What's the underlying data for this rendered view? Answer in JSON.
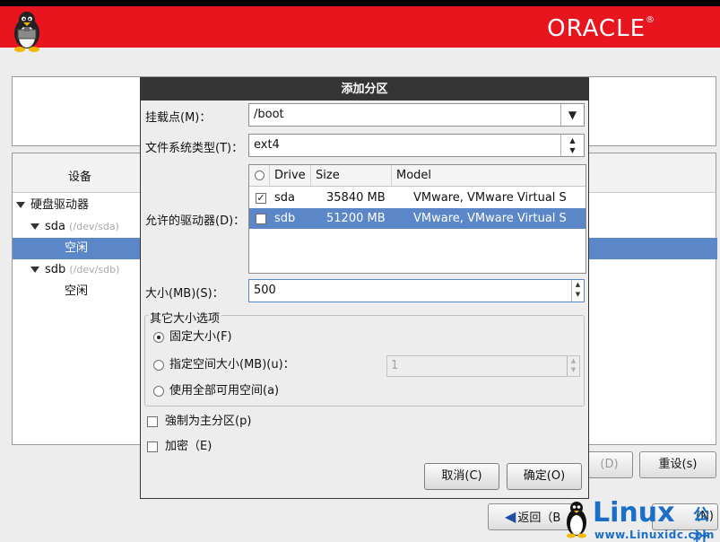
{
  "banner": {
    "brand": "ORACLE",
    "brand_mark": "®",
    "color": "#e8141e"
  },
  "device_panel": {
    "column_header": "设备",
    "tree": [
      {
        "label": "硬盘驱动器",
        "sub": ""
      },
      {
        "label": "sda",
        "sub": "(/dev/sda)"
      },
      {
        "label": "空闲",
        "sub": ""
      },
      {
        "label": "sdb",
        "sub": "(/dev/sdb)"
      },
      {
        "label": "空闲",
        "sub": ""
      }
    ],
    "selected_color": "#5b86c7"
  },
  "background_buttons": {
    "hidden": "(D)",
    "reset": "重设(s)",
    "back": "返回（B",
    "next": "(N)"
  },
  "watermark": {
    "linux": "Linux",
    "site": "公社",
    "url": "www.Linuxidc.com",
    "color": "#1a6ec8"
  },
  "dialog": {
    "title": "添加分区",
    "mount_point": {
      "label": "挂载点(M)：",
      "value": "/boot"
    },
    "fs_type": {
      "label": "文件系统类型(T)：",
      "value": "ext4"
    },
    "drives": {
      "label": "允许的驱动器(D)：",
      "columns": [
        "Drive",
        "Size",
        "Model"
      ],
      "rows": [
        {
          "checked": true,
          "drive": "sda",
          "size": "35840 MB",
          "model": "VMware, VMware Virtual S",
          "selected": false
        },
        {
          "checked": false,
          "drive": "sdb",
          "size": "51200 MB",
          "model": "VMware, VMware Virtual S",
          "selected": true
        }
      ]
    },
    "size": {
      "label": "大小(MB)(S)：",
      "value": "500"
    },
    "other_options": {
      "legend": "其它大小选项",
      "fixed": {
        "label": "固定大小(F)",
        "selected": true
      },
      "up_to": {
        "label": "指定空间大小(MB)(u)：",
        "selected": false,
        "value": "1"
      },
      "fill": {
        "label": "使用全部可用空间(a)",
        "selected": false
      }
    },
    "force_primary": {
      "label": "強制为主分区(p)",
      "checked": false
    },
    "encrypt": {
      "label": "加密（E)",
      "checked": false
    },
    "cancel_label": "取消(C)",
    "ok_label": "确定(O)"
  }
}
